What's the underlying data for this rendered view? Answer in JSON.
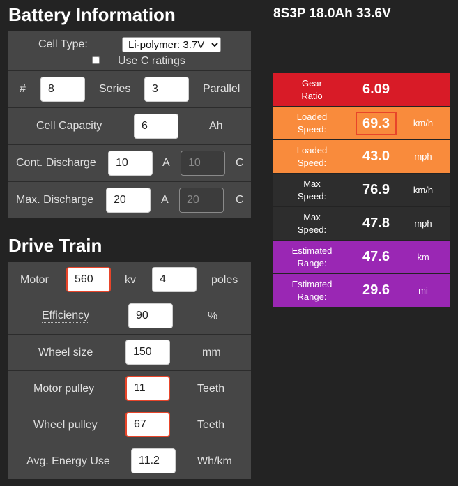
{
  "battery": {
    "heading": "Battery Information",
    "cell_type_label": "Cell Type:",
    "cell_type_selected": "Li-polymer: 3.7V",
    "use_c_ratings_label": "Use C ratings",
    "hash_label": "#",
    "series_value": "8",
    "series_label": "Series",
    "parallel_value": "3",
    "parallel_label": "Parallel",
    "cell_capacity_label": "Cell Capacity",
    "cell_capacity_value": "6",
    "cell_capacity_unit": "Ah",
    "cont_discharge_label": "Cont. Discharge",
    "cont_discharge_a_value": "10",
    "cont_discharge_a_unit": "A",
    "cont_discharge_c_value": "10",
    "cont_discharge_c_unit": "C",
    "max_discharge_label": "Max. Discharge",
    "max_discharge_a_value": "20",
    "max_discharge_a_unit": "A",
    "max_discharge_c_value": "20",
    "max_discharge_c_unit": "C"
  },
  "drive": {
    "heading": "Drive Train",
    "motor_label": "Motor",
    "motor_kv_value": "560",
    "kv_label": "kv",
    "poles_value": "4",
    "poles_label": "poles",
    "efficiency_label": "Efficiency",
    "efficiency_value": "90",
    "efficiency_unit": "%",
    "wheel_size_label": "Wheel size",
    "wheel_size_value": "150",
    "wheel_size_unit": "mm",
    "motor_pulley_label": "Motor pulley",
    "motor_pulley_value": "11",
    "motor_pulley_unit": "Teeth",
    "wheel_pulley_label": "Wheel pulley",
    "wheel_pulley_value": "67",
    "wheel_pulley_unit": "Teeth",
    "energy_label": "Avg. Energy Use",
    "energy_value": "11.2",
    "energy_unit": "Wh/km"
  },
  "summary": {
    "pack_spec": "8S3P 18.0Ah 33.6V"
  },
  "results": [
    {
      "label": "Gear Ratio",
      "value": "6.09",
      "unit": "",
      "color": "#d81b27"
    },
    {
      "label": "Loaded Speed:",
      "value": "69.3",
      "unit": "km/h",
      "color": "#f98b3c"
    },
    {
      "label": "Loaded Speed:",
      "value": "43.0",
      "unit": "mph",
      "color": "#f98b3c"
    },
    {
      "label": "Max Speed:",
      "value": "76.9",
      "unit": "km/h",
      "color": "#2d2d2d"
    },
    {
      "label": "Max Speed:",
      "value": "47.8",
      "unit": "mph",
      "color": "#2d2d2d"
    },
    {
      "label": "Estimated Range:",
      "value": "47.6",
      "unit": "km",
      "color": "#9a27b4"
    },
    {
      "label": "Estimated Range:",
      "value": "29.6",
      "unit": "mi",
      "color": "#9a27b4"
    }
  ],
  "colors": {
    "highlight_border": "#e8452a",
    "panel_bg": "#464646",
    "page_bg": "#232323"
  }
}
